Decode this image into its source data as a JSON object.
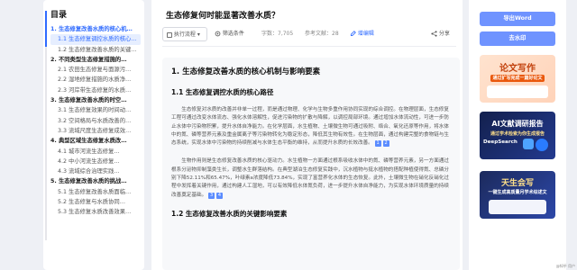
{
  "toc": {
    "title": "目录",
    "items": [
      {
        "label": "1. 生态修复改善水质的核心机…",
        "level": 1,
        "state": "active"
      },
      {
        "label": "1.1 生态修复调控水质的核心…",
        "level": 2,
        "state": "sel"
      },
      {
        "label": "1.2 生态修复改善水质的关键…",
        "level": 2,
        "state": ""
      },
      {
        "label": "2. 不同类型生态修复措施的…",
        "level": 1,
        "state": ""
      },
      {
        "label": "2.1 农田生态修复与面源污…",
        "level": 2,
        "state": ""
      },
      {
        "label": "2.2 湿地修复措施的水质净…",
        "level": 2,
        "state": ""
      },
      {
        "label": "2.3 河岸带生态修复的水质…",
        "level": 2,
        "state": ""
      },
      {
        "label": "3. 生态修复改善水质的时空…",
        "level": 1,
        "state": ""
      },
      {
        "label": "3.1 生态修复效果的时间动…",
        "level": 2,
        "state": ""
      },
      {
        "label": "3.2 空间格局与水质改善的…",
        "level": 2,
        "state": ""
      },
      {
        "label": "3.3 流域尺度生态修复成效…",
        "level": 2,
        "state": ""
      },
      {
        "label": "4. 典型区域生态修复水质改…",
        "level": 1,
        "state": ""
      },
      {
        "label": "4.1 城市河流生态修复…",
        "level": 2,
        "state": ""
      },
      {
        "label": "4.2 中小河流生态修复…",
        "level": 2,
        "state": ""
      },
      {
        "label": "4.3 流域综合治理实践…",
        "level": 2,
        "state": ""
      },
      {
        "label": "5. 生态修复改善水质的挑战…",
        "level": 1,
        "state": ""
      },
      {
        "label": "5.1 生态修复改善水质面临…",
        "level": 2,
        "state": ""
      },
      {
        "label": "5.2 生态修复与水质协同…",
        "level": 2,
        "state": ""
      },
      {
        "label": "5.3 生态修复水质改善效果…",
        "level": 2,
        "state": ""
      }
    ]
  },
  "doc": {
    "title": "生态修复何时能显著改善水质？",
    "toolbar": {
      "workflow": "执行流程",
      "filter": "筛选条件",
      "words": "字数：7,705",
      "refs": "参考文献：28",
      "add": "增编辑",
      "share": "分享"
    },
    "h1": "1. 生态修复改善水质的核心机制与影响要素",
    "h2a": "1.1 生态修复调控水质的核心路径",
    "p1": "生态修复对水质的改善并非单一过程，而是通过物理、化学与生物多重作用协同实现的综合调控。在物理层面，生态修复工程可通过改变水体流态、强化水体溶解性，促进污染物的扩散与降解，以调控局部环境。通过增加水体流动性，可进一步防止水体中污染物积累，提升水体自净能力。在化学层面，水生植物、土壤微生物可通过吸附、络合、氧化还原等作用，将水体中的氮、磷等营养元素及重金属离子等污染物转化为稳定形态，降低其生物有效性。在生物层面，通过构建完整的食物链与生态系统，实现水体中污染物的持续削减与水体生态平衡的维持，从而提升水质的长效改善。",
    "ref1": "1",
    "ref2": "2",
    "p2": "生物作用则是生态修复改善水质的核心驱动力。水生植物一方面通过根系吸收水体中的氮、磷等营养元素，另一方面通过根系分泌物抑制藻类生长，调整水生群落结构。在典型湖泊生态修复实践中，沉水植物与挺水植物的搭配种植使得氮、总磷分别下降52.11%和65.47%，叶绿素a浓度降低73.84%，实现了富营养化水体的生态恢复。此外，土壤微生物在硝化反硝化过程中发挥着关键作用，通过构建人工湿地，可以有效降低水体氮负荷，进一步提升水体自净能力，为实现水体环境质量的持续改善奠定基础。",
    "ref3": "3",
    "ref4": "4",
    "h2b": "1.2 生态修复改善水质的关键影响要素"
  },
  "side": {
    "export_label": "导出Word",
    "watermark_label": "去水印",
    "banner1_title": "论文写作",
    "banner1_sub": "通过扩写完成一篇好论文",
    "banner2_title": "AI文献调研报告",
    "banner2_sub": "通过学术检索为你生成报告",
    "banner2_brand": "DeepSearch",
    "banner3_title": "天生会写",
    "banner3_sub": "一键生成高质量月学术综述文"
  },
  "footer_tag": "@知乎 用户"
}
